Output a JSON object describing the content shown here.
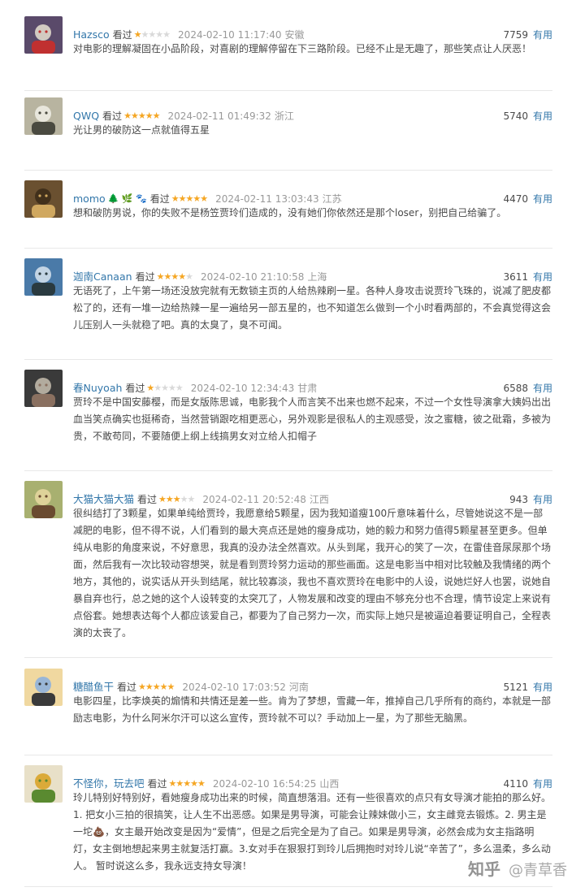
{
  "reviews": [
    {
      "user": "Hazsco",
      "badges": "",
      "status": "看过",
      "rating": 1,
      "time": "2024-02-10 11:17:40",
      "location": "安徽",
      "votes": "7759",
      "useful_label": "有用",
      "text": "对电影的理解凝固在小品阶段，对喜剧的理解停留在下三路阶段。已经不止是无趣了，那些笑点让人厌恶！",
      "avatar": {
        "bg": "#5a4a6a",
        "fg": "#c03030",
        "accent": "#e8e0d0"
      }
    },
    {
      "user": "QWQ",
      "badges": "",
      "status": "看过",
      "rating": 5,
      "time": "2024-02-11 01:49:32",
      "location": "浙江",
      "votes": "5740",
      "useful_label": "有用",
      "text": "光让男的破防这一点就值得五星",
      "avatar": {
        "bg": "#b8b4a0",
        "fg": "#4a4a40",
        "accent": "#f0efe6"
      }
    },
    {
      "user": "momo",
      "badges": "🌲 🌿 🐾",
      "status": "看过",
      "rating": 5,
      "time": "2024-02-11 13:03:43",
      "location": "江苏",
      "votes": "4470",
      "useful_label": "有用",
      "text": "想和破防男说，你的失败不是杨笠贾玲们造成的，没有她们你依然还是那个loser，别把自己给骗了。",
      "avatar": {
        "bg": "#6a5030",
        "fg": "#d0a860",
        "accent": "#3a2a18"
      }
    },
    {
      "user": "迦南Canaan",
      "badges": "",
      "status": "看过",
      "rating": 4,
      "time": "2024-02-10 21:10:58",
      "location": "上海",
      "votes": "3611",
      "useful_label": "有用",
      "text": "无语死了，上午第一场还没放完就有无数锁主页的人给热辣刷一星。各种人身攻击说贾玲飞珠的，说减了肥皮都松了的，还有一堆一边给热辣一星一遍给另一部五星的，也不知道怎么做到一个小时看两部的，不会真觉得这会儿压别人一头就稳了吧。真的太臭了，臭不可闻。",
      "avatar": {
        "bg": "#4a7aa8",
        "fg": "#2a3a40",
        "accent": "#d8e4ee"
      }
    },
    {
      "user": "春Nuyoah",
      "badges": "",
      "status": "看过",
      "rating": 1,
      "time": "2024-02-10 12:34:43",
      "location": "甘肃",
      "votes": "6588",
      "useful_label": "有用",
      "text": "贾玲不是中国安藤樱，而是女版陈思诚，电影我个人而言笑不出来也燃不起来，不过一个女性导演拿大姨妈出出血当笑点确实也挺稀奇，当然营销跟吃相更恶心，另外观影是很私人的主观感受，汝之蜜糖，彼之砒霜，多被为贵，不敢苟同，不要随便上纲上线搞男女对立给人扣帽子",
      "avatar": {
        "bg": "#3a3a3a",
        "fg": "#8a7060",
        "accent": "#c8c0b0"
      }
    },
    {
      "user": "大猫大猫大猫",
      "badges": "",
      "status": "看过",
      "rating": 3,
      "time": "2024-02-11 20:52:48",
      "location": "江西",
      "votes": "943",
      "useful_label": "有用",
      "text": "很纠结打了3颗星，如果单纯给贾玲，我愿意给5颗星，因为我知道瘦100斤意味着什么，尽管她说这不是一部减肥的电影，但不得不说，人们看到的最大亮点还是她的瘦身成功，她的毅力和努力值得5颗星甚至更多。但单纯从电影的角度来说，不好意思，我真的没办法全然喜欢。从头到尾，我开心的笑了一次，在雷佳音尿尿那个场面，然后我有一次比较动容想哭，就是看到贾玲努力运动的那些画面。这是电影当中相对比较触及我情绪的两个地方，其他的，说实话从开头到结尾，就比较寡淡，我也不喜欢贾玲在电影中的人设，说她烂好人也罢，说她自暴自弃也行，总之她的这个人设转变的太突兀了，人物发展和改变的理由不够充分也不合理，情节设定上来说有点俗套。她想表达每个人都应该爱自己，都要为了自己努力一次，而实际上她只是被逼迫着要证明自己，全程表演的太丧了。",
      "avatar": {
        "bg": "#a8b070",
        "fg": "#6a4a30",
        "accent": "#e8d8a0"
      }
    },
    {
      "user": "糖醋鱼干",
      "badges": "",
      "status": "看过",
      "rating": 5,
      "time": "2024-02-10 17:03:52",
      "location": "河南",
      "votes": "5121",
      "useful_label": "有用",
      "text": "电影四星，比李焕英的煽情和共情还是差一些。肯为了梦想，雪藏一年，推掉自己几乎所有的商约，本就是一部励志电影，为什么阿米尔汗可以这么宣传，贾玲就不可以？手动加上一星，为了那些无脑黑。",
      "avatar": {
        "bg": "#f0d8a0",
        "fg": "#3a3a3a",
        "accent": "#8ab0e0"
      }
    },
    {
      "user": "不怪你，玩去吧",
      "badges": "",
      "status": "看过",
      "rating": 5,
      "time": "2024-02-10 16:54:25",
      "location": "山西",
      "votes": "4110",
      "useful_label": "有用",
      "text": "玲儿特别好特别好，看她瘦身成功出来的时候，简直想落泪。还有一些很喜欢的点只有女导演才能拍的那么好。1. 把女小三拍的很搞笑，让人生不出恶感。如果是男导演，可能会让辣妹做小三，女主雌竞去锻炼。2. 男主是一坨💩，女主最开始改变是因为“爱情”，但是之后完全是为了自己。如果是男导演，必然会成为女主指路明灯，女主倒地想起来男主就复活打赢。3.女对手在狠狠打到玲儿后拥抱时对玲儿说“辛苦了”，多么温柔，多么动人。 暂时说这么多，我永远支持女导演！",
      "avatar": {
        "bg": "#e8e0c8",
        "fg": "#5a8a30",
        "accent": "#d8a020"
      }
    }
  ],
  "watermark": {
    "brand": "知乎",
    "user": "@青草香"
  }
}
